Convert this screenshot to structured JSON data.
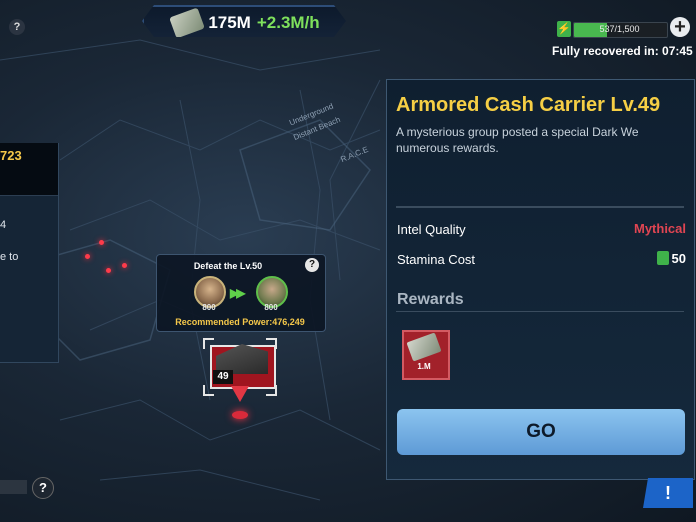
{
  "resources": {
    "cash_amount": "175M",
    "cash_rate": "+2.3M/h",
    "cash_icon": "cash-icon"
  },
  "stamina": {
    "text": "537/1,500",
    "fraction": 0.358,
    "recovery_text": "Fully recovered in: 07:45"
  },
  "help_glyph": "?",
  "plus_glyph": "+",
  "left_panel": {
    "number": "723",
    "line1": "4",
    "line2": "e to"
  },
  "map_labels": [
    "Underground",
    "Distant Beach",
    "R.A.C.E"
  ],
  "target": {
    "title": "Defeat the Lv.50",
    "power_label": "Recommended Power:476,249",
    "attacker_power": "800",
    "defender_power": "800",
    "marker_level": "49"
  },
  "detail": {
    "title": "Armored Cash Carrier Lv.49",
    "description": "A mysterious group posted a special Dark We numerous rewards.",
    "intel_label": "Intel Quality",
    "intel_value": "Mythical",
    "stamina_label": "Stamina Cost",
    "stamina_value": "50",
    "rewards_heading": "Rewards",
    "reward_qty": "1.M",
    "go_label": "GO"
  },
  "alert_glyph": "!",
  "colors": {
    "accent_gold": "#f6cf45",
    "mythical_red": "#e04552",
    "go_blue": "#7bb4e6",
    "stamina_green": "#49b84f"
  }
}
